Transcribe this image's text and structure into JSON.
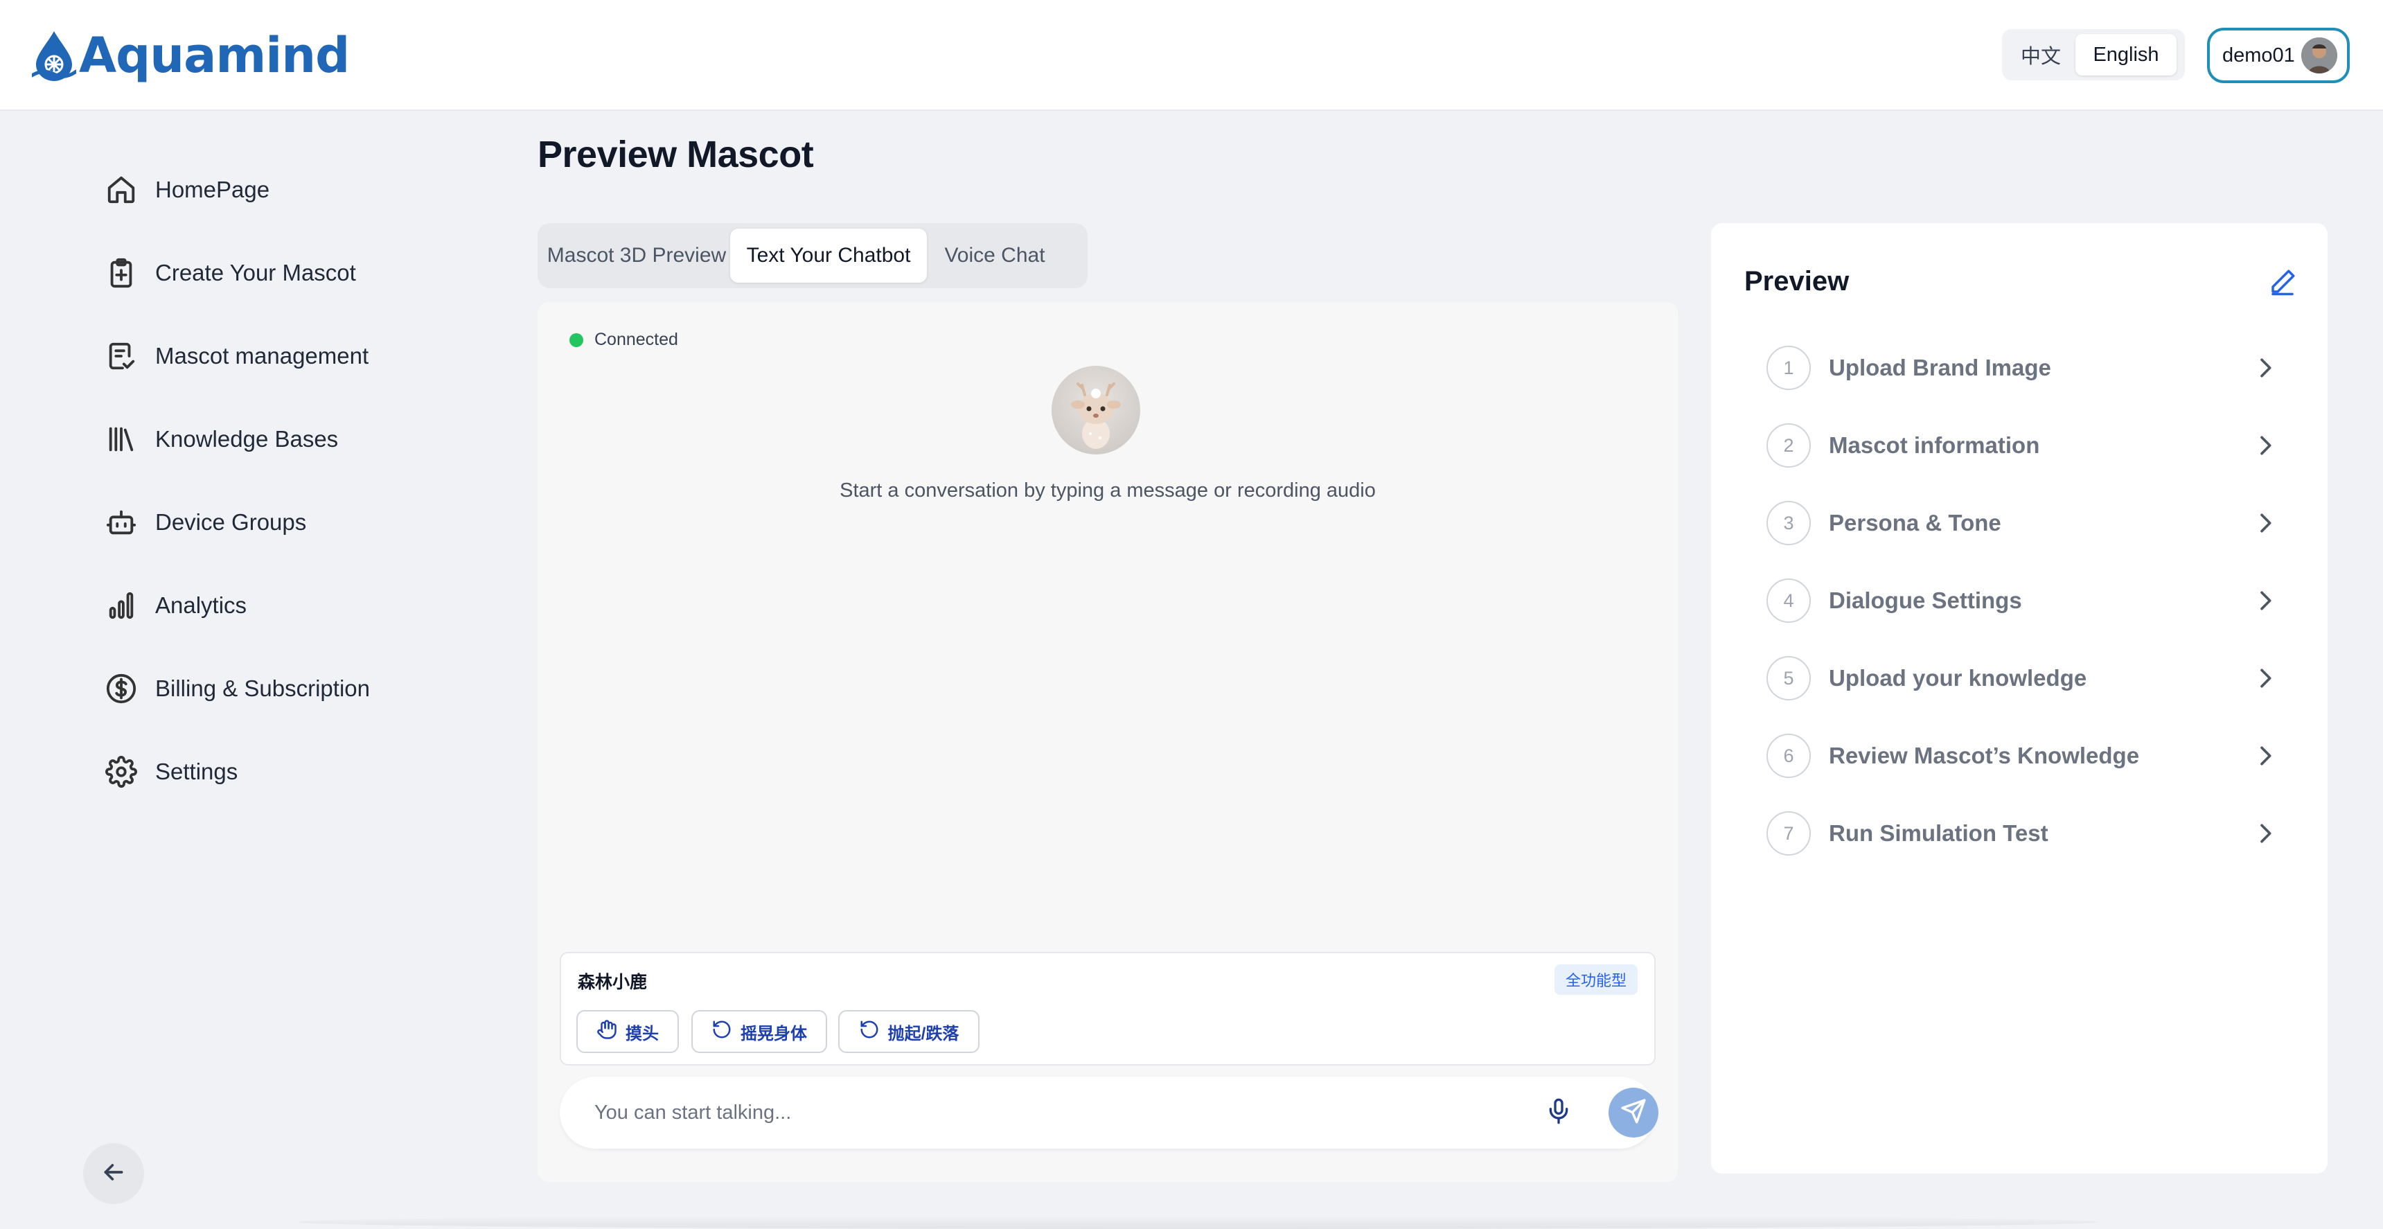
{
  "brand": {
    "name": "Aquamind",
    "color": "#2167b8"
  },
  "header": {
    "languages": [
      {
        "label": "中文",
        "active": false
      },
      {
        "label": "English",
        "active": true
      }
    ],
    "user": {
      "name": "demo01"
    }
  },
  "sidebar": {
    "items": [
      {
        "label": "HomePage",
        "icon": "home-icon"
      },
      {
        "label": "Create Your Mascot",
        "icon": "clipboard-plus-icon"
      },
      {
        "label": "Mascot management",
        "icon": "clipboard-check-icon"
      },
      {
        "label": "Knowledge Bases",
        "icon": "library-icon"
      },
      {
        "label": "Device Groups",
        "icon": "robot-icon"
      },
      {
        "label": "Analytics",
        "icon": "bar-chart-icon"
      },
      {
        "label": "Billing & Subscription",
        "icon": "dollar-circle-icon"
      },
      {
        "label": "Settings",
        "icon": "gear-icon"
      }
    ],
    "collapse_icon": "arrow-left-icon"
  },
  "main": {
    "title": "Preview Mascot",
    "tabs": [
      {
        "label": "Mascot 3D Preview",
        "active": false
      },
      {
        "label": "Text Your Chatbot",
        "active": true
      },
      {
        "label": "Voice Chat",
        "active": false
      }
    ],
    "chat": {
      "status": "Connected",
      "status_color": "#22c55e",
      "empty_message": "Start a conversation by typing a message or recording audio",
      "mascot": {
        "name": "森林小鹿",
        "tag": "全功能型",
        "actions": [
          {
            "label": "摸头",
            "icon": "hand-icon"
          },
          {
            "label": "摇晃身体",
            "icon": "rotate-icon"
          },
          {
            "label": "抛起/跌落",
            "icon": "rotate-icon"
          }
        ]
      },
      "input": {
        "placeholder": "You can start talking...",
        "value": ""
      }
    }
  },
  "preview": {
    "title": "Preview",
    "steps": [
      {
        "num": "1",
        "label": "Upload Brand Image"
      },
      {
        "num": "2",
        "label": "Mascot information"
      },
      {
        "num": "3",
        "label": "Persona & Tone"
      },
      {
        "num": "4",
        "label": "Dialogue Settings"
      },
      {
        "num": "5",
        "label": "Upload your knowledge"
      },
      {
        "num": "6",
        "label": "Review Mascot’s Knowledge"
      },
      {
        "num": "7",
        "label": "Run Simulation Test"
      }
    ]
  }
}
